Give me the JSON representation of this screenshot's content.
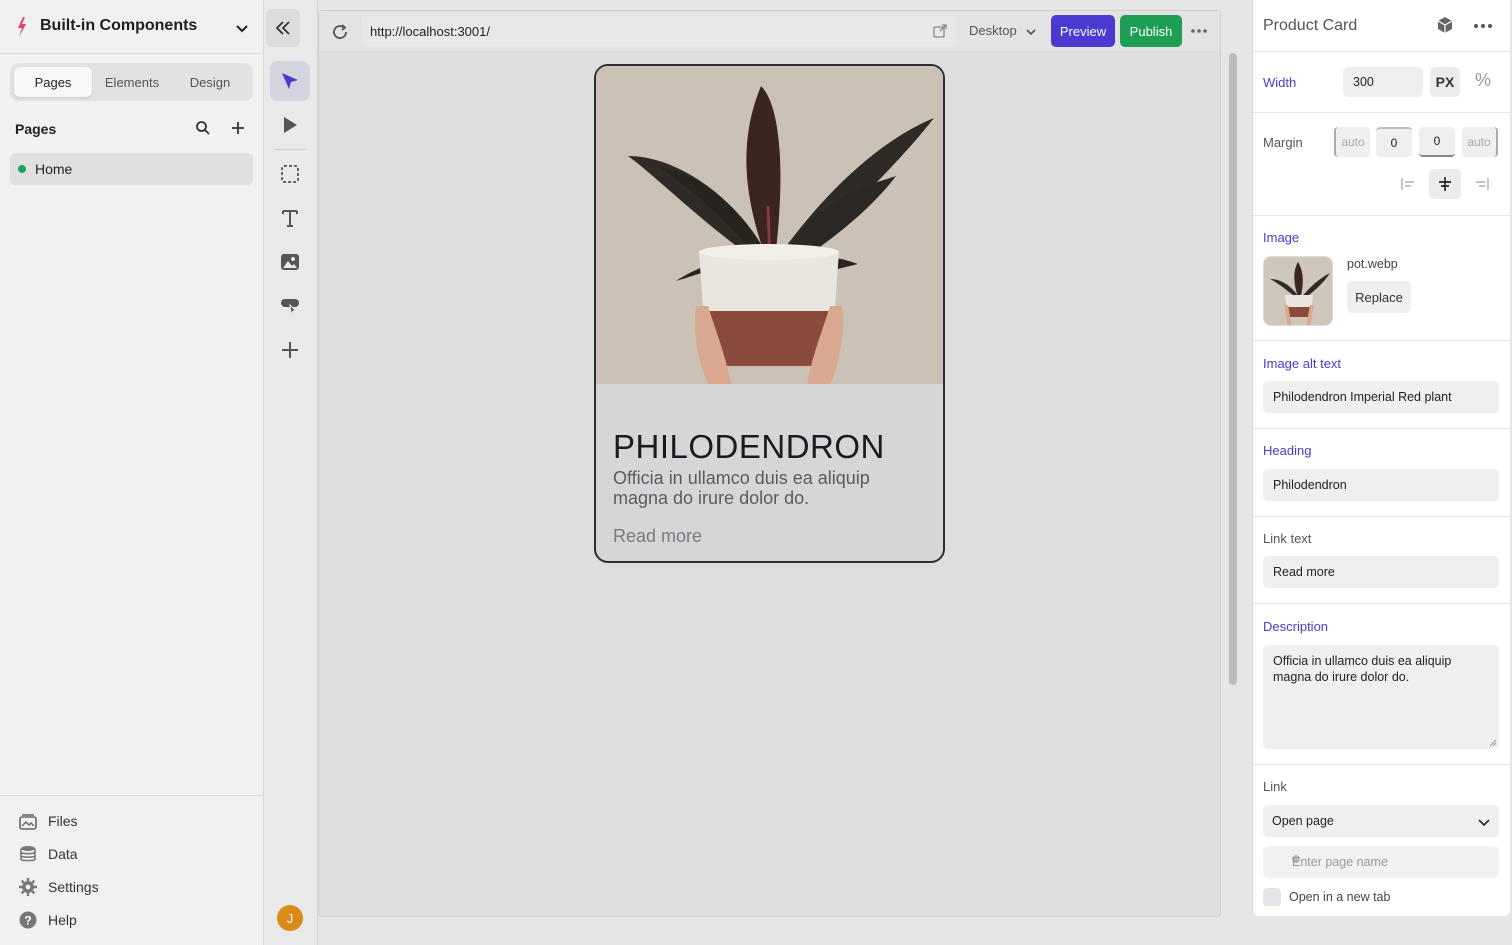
{
  "project": {
    "name": "Built-in Components"
  },
  "sidebar": {
    "tabs": [
      {
        "label": "Pages",
        "active": true
      },
      {
        "label": "Elements",
        "active": false
      },
      {
        "label": "Design",
        "active": false
      }
    ],
    "pages_title": "Pages",
    "pages": [
      {
        "label": "Home",
        "status_color": "#1fa05a"
      }
    ],
    "footer": [
      {
        "label": "Files",
        "icon": "files-icon"
      },
      {
        "label": "Data",
        "icon": "database-icon"
      },
      {
        "label": "Settings",
        "icon": "gear-icon"
      },
      {
        "label": "Help",
        "icon": "help-icon"
      }
    ]
  },
  "toolbar": {
    "tools": [
      "cursor-icon",
      "play-icon",
      "container-icon",
      "text-icon",
      "image-icon",
      "component-icon",
      "plus-icon"
    ],
    "avatar_initial": "J"
  },
  "browser": {
    "url": "http://localhost:3001/",
    "device": "Desktop",
    "preview_label": "Preview",
    "publish_label": "Publish"
  },
  "card": {
    "title": "PHILODENDRON",
    "description": "Officia in ullamco duis ea aliquip magna do irure dolor do.",
    "link": "Read more"
  },
  "panel": {
    "title": "Product Card",
    "width_label": "Width",
    "width_value": "300",
    "unit_px": "PX",
    "unit_pct": "%",
    "margin_label": "Margin",
    "margin": {
      "left": "auto",
      "top": "0",
      "bottom": "0",
      "right": "auto"
    },
    "image_label": "Image",
    "image_file": "pot.webp",
    "replace_label": "Replace",
    "alt_label": "Image alt text",
    "alt_value": "Philodendron Imperial Red plant",
    "heading_label": "Heading",
    "heading_value": "Philodendron",
    "linktext_label": "Link text",
    "linktext_value": "Read more",
    "description_label": "Description",
    "description_value": "Officia in ullamco duis ea aliquip magna do irure dolor do.",
    "link_label": "Link",
    "link_type": "Open page",
    "page_name_placeholder": "Enter page name",
    "new_tab_label": "Open in a new tab"
  },
  "colors": {
    "accent": "#4a3ad1",
    "publish": "#1e9e55",
    "avatar": "#d98a18"
  }
}
